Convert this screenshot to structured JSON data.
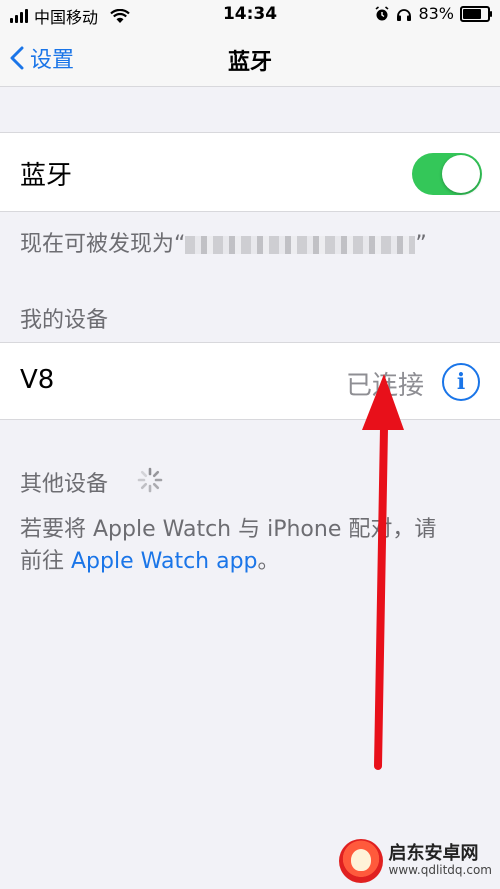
{
  "status_bar": {
    "carrier": "中国移动",
    "time": "14:34",
    "battery_percent": "83%",
    "battery_level": 0.83,
    "icons": [
      "signal-icon",
      "wifi-icon",
      "alarm-icon",
      "headphones-icon",
      "battery-icon"
    ]
  },
  "nav": {
    "back_label": "设置",
    "title": "蓝牙"
  },
  "bluetooth": {
    "label": "蓝牙",
    "enabled": true,
    "toggle_color": "#34c759"
  },
  "discoverable": {
    "text": "现在可被发现为“",
    "close_quote": "”"
  },
  "my_devices": {
    "header": "我的设备",
    "devices": [
      {
        "name": "V8",
        "status": "已连接"
      }
    ]
  },
  "other_devices": {
    "header": "其他设备",
    "hint_line1": "若要将 Apple Watch 与 iPhone 配对，请",
    "hint_line2_prefix": "前往 ",
    "hint_link": "Apple Watch app",
    "hint_line2_suffix": "。"
  },
  "colors": {
    "accent": "#1a75e8",
    "annotation_arrow": "#e8101a"
  },
  "watermark": {
    "title": "启东安卓网",
    "url": "www.qdlitdq.com"
  }
}
